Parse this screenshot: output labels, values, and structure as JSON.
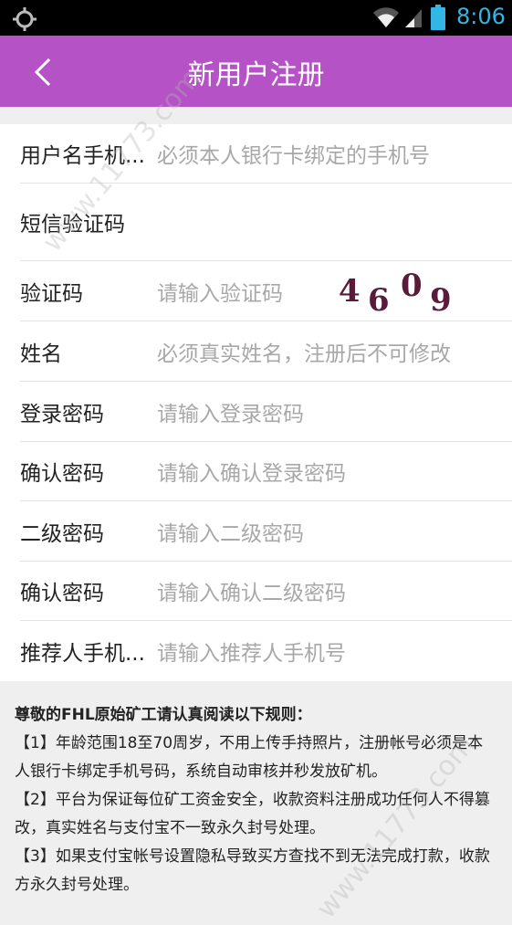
{
  "status_bar": {
    "time": "8:06",
    "icons": [
      "gps-icon",
      "wifi-icon",
      "signal-icon",
      "battery-icon"
    ]
  },
  "app_bar": {
    "title": "新用户注册",
    "back_icon": "back-arrow-icon",
    "color": "#b553c6"
  },
  "form": {
    "rows": [
      {
        "label": "用户名手机...",
        "placeholder": "必须本人银行卡绑定的手机号"
      },
      {
        "label": "短信验证码",
        "placeholder": ""
      },
      {
        "label": "验证码",
        "placeholder": "请输入验证码",
        "captcha": "4609"
      },
      {
        "label": "姓名",
        "placeholder": "必须真实姓名，注册后不可修改"
      },
      {
        "label": "登录密码",
        "placeholder": "请输入登录密码"
      },
      {
        "label": "确认密码",
        "placeholder": "请输入确认登录密码"
      },
      {
        "label": "二级密码",
        "placeholder": "请输入二级密码"
      },
      {
        "label": "确认密码",
        "placeholder": "请输入确认二级密码"
      },
      {
        "label": "推荐人手机...",
        "placeholder": "请输入推荐人手机号"
      }
    ]
  },
  "rules": {
    "title": "尊敬的FHL原始矿工请认真阅读以下规则：",
    "items": [
      "【1】年龄范围18至70周岁，不用上传手持照片，注册帐号必须是本人银行卡绑定手机号码，系统自动审核并秒发放矿机。",
      "【2】平台为保证每位矿工资金安全，收款资料注册成功任何人不得篡改，真实姓名与支付宝不一致永久封号处理。",
      "【3】如果支付宝帐号设置隐私导致买方查找不到无法完成打款，收款方永久封号处理。"
    ]
  },
  "watermark": "www.11773.com"
}
